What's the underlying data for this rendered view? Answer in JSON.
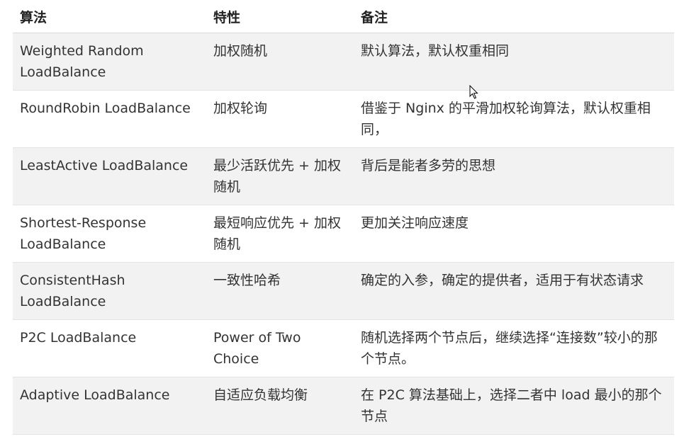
{
  "table": {
    "headers": [
      "算法",
      "特性",
      "备注"
    ],
    "rows": [
      [
        "Weighted Random LoadBalance",
        "加权随机",
        "默认算法，默认权重相同"
      ],
      [
        "RoundRobin LoadBalance",
        "加权轮询",
        "借鉴于 Nginx 的平滑加权轮询算法，默认权重相同，"
      ],
      [
        "LeastActive LoadBalance",
        "最少活跃优先 + 加权随机",
        "背后是能者多劳的思想"
      ],
      [
        "Shortest-Response LoadBalance",
        "最短响应优先 + 加权随机",
        "更加关注响应速度"
      ],
      [
        "ConsistentHash LoadBalance",
        "一致性哈希",
        "确定的入参，确定的提供者，适用于有状态请求"
      ],
      [
        "P2C LoadBalance",
        "Power of Two Choice",
        "随机选择两个节点后，继续选择“连接数”较小的那个节点。"
      ],
      [
        "Adaptive LoadBalance",
        "自适应负载均衡",
        "在 P2C 算法基础上，选择二者中 load 最小的那个节点"
      ]
    ]
  },
  "cursor": {
    "icon": "mouse-pointer-icon"
  }
}
